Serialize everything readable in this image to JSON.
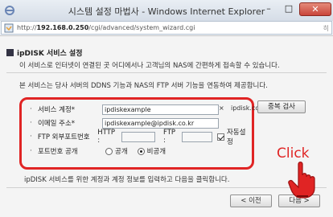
{
  "window": {
    "title": "시스템 설정 마법사 - Windows Internet Explorer",
    "minimize": "–",
    "maximize": "□",
    "close": "✕"
  },
  "address": {
    "prefix": "http://",
    "host": "192.168.0.250",
    "path": "/cgi/advanced/system_wizard.cgi",
    "right_marker": "히"
  },
  "section": {
    "title": "ipDISK 서비스 설정",
    "desc1": "이 서비스로 인터넷이 연결된 곳 어디에서나 고객님의 NAS에 간편하게 접속할 수 있습니다.",
    "desc2": "본 서비스는 당사 서버의 DDNS 기능과 NAS의 FTP 서버 기능을 연동하여 제공합니다."
  },
  "form": {
    "service_account_label": "서비스 계정*",
    "service_account_value": "ipdiskexample",
    "clear_glyph": "×",
    "domain_suffix": "ipdisk.co.kr",
    "email_label": "이메일 주소*",
    "email_value": "ipdiskexample@ipdisk.co.kr",
    "ftp_label": "FTP 외부포트번호",
    "http_label": "HTTP :",
    "ftp_port_label": "FTP :",
    "auto_setting_label": "자동설정",
    "port_public_label": "포트번호 공개",
    "public_option": "공개",
    "private_option": "비공개"
  },
  "buttons": {
    "duplicate_check": "중복 검사",
    "prev": "< 이전",
    "next": "다음 >"
  },
  "footer": {
    "instruction": "ipDISK 서비스를 위한 계정과 계정 정보를 입력하고 다음을 클릭합니다."
  },
  "annotation": {
    "click_text": "Click"
  },
  "colors": {
    "highlight": "#e02424",
    "titlebar": "#d5dde7"
  }
}
